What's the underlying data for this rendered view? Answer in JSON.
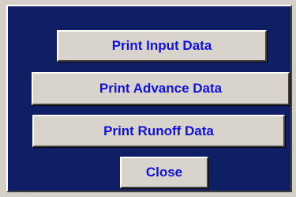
{
  "colors": {
    "panel_background": "#0e1f66",
    "button_face": "#d8d4cc",
    "button_text": "#1010e0"
  },
  "buttons": {
    "print_input_data": "Print Input Data",
    "print_advance_data": "Print Advance Data",
    "print_runoff_data": "Print Runoff Data",
    "close": "Close"
  }
}
